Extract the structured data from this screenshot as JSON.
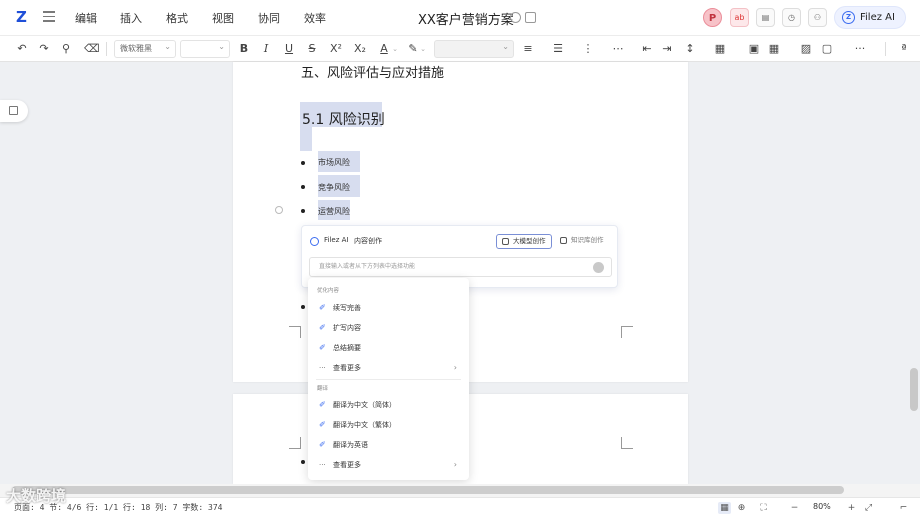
{
  "menubar": {
    "logo": "Z",
    "items": [
      "编辑",
      "插入",
      "格式",
      "视图",
      "协同",
      "效率"
    ],
    "doc_title": "XX客户营销方案",
    "avatar_letter": "P",
    "ai_button": "Filez AI"
  },
  "toolbar": {
    "font_name": "微软雅黑",
    "bold": "B",
    "italic": "I",
    "underline": "U",
    "strike": "S",
    "superscript": "X²",
    "subscript": "X₂",
    "font_color": "A",
    "more": "···"
  },
  "document": {
    "heading5": "五、风险评估与应对措施",
    "heading51": "5.1  风险识别",
    "bullets": [
      "市场风险",
      "竞争风险",
      "运营风险"
    ]
  },
  "ai_panel": {
    "name": "Filez AI",
    "subtitle": "内容创作",
    "mode_active": "大模型创作",
    "mode_inactive": "知识库创作",
    "input_placeholder": "直接输入或者从下方列表中选择功能"
  },
  "dropdown": {
    "group1_label": "优化内容",
    "group1_items": [
      "续写完善",
      "扩写内容",
      "总结摘要"
    ],
    "group1_more": "查看更多",
    "group2_label": "翻译",
    "group2_items": [
      "翻译为中文（简体）",
      "翻译为中文（繁体）",
      "翻译为英语"
    ],
    "group2_more": "查看更多"
  },
  "statusbar": {
    "text": "页面: 4  节: 4/6  行: 1/1  行: 18  列: 7  字数: 374",
    "zoom": "80%",
    "watermark": "大数跨境"
  },
  "colors": {
    "accent": "#3b6cf0",
    "selection": "#d7ddef"
  }
}
